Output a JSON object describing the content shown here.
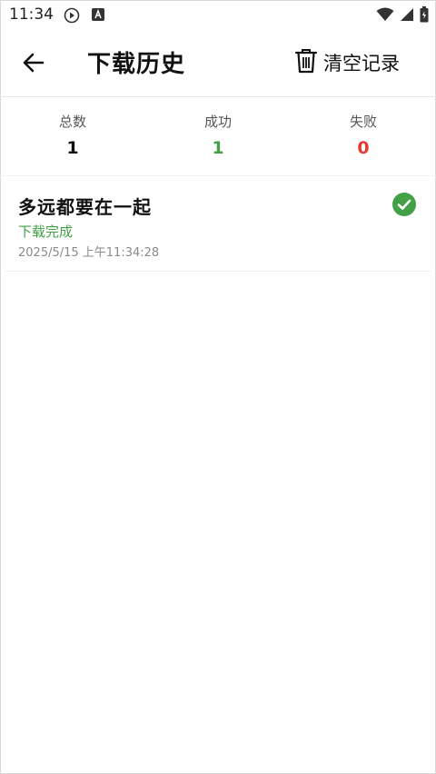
{
  "status_bar": {
    "time": "11:34",
    "icons": [
      "play-circle-icon",
      "a-badge-icon",
      "wifi-icon",
      "signal-icon",
      "battery-icon"
    ]
  },
  "app_bar": {
    "title": "下载历史",
    "back_icon": "arrow-left-icon",
    "clear_label": "清空记录",
    "clear_icon": "trash-icon"
  },
  "stats": {
    "total": {
      "label": "总数",
      "value": "1",
      "color": "#111111"
    },
    "success": {
      "label": "成功",
      "value": "1",
      "color": "#43a047"
    },
    "failed": {
      "label": "失败",
      "value": "0",
      "color": "#e53935"
    }
  },
  "history": [
    {
      "title": "多远都要在一起",
      "status": "下载完成",
      "timestamp": "2025/5/15 上午11:34:28",
      "status_color": "#43a047",
      "icon": "check-circle-icon"
    }
  ]
}
